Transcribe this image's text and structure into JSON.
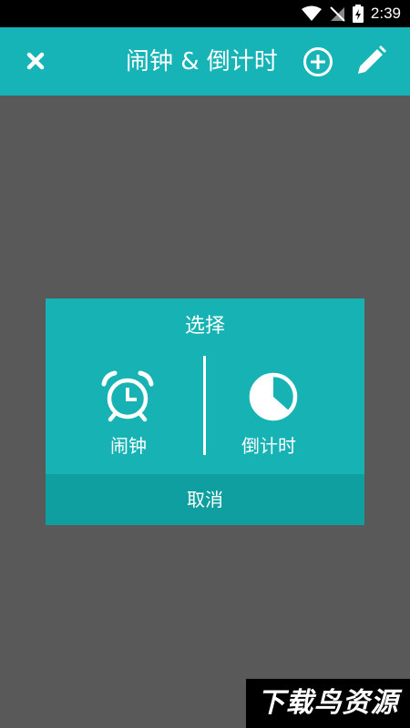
{
  "status_bar": {
    "time": "2:39"
  },
  "app_bar": {
    "title": "闹钟 & 倒计时"
  },
  "dialog": {
    "title": "选择",
    "options": [
      {
        "label": "闹钟",
        "icon": "alarm-clock-icon"
      },
      {
        "label": "倒计时",
        "icon": "timer-pie-icon"
      }
    ],
    "cancel_label": "取消"
  },
  "watermark": {
    "text": "下载鸟资源"
  },
  "colors": {
    "accent": "#17b4b7",
    "dialog_bg": "#16b2b4",
    "cancel_bg": "#0f9fa1",
    "scrim": "#595959"
  }
}
